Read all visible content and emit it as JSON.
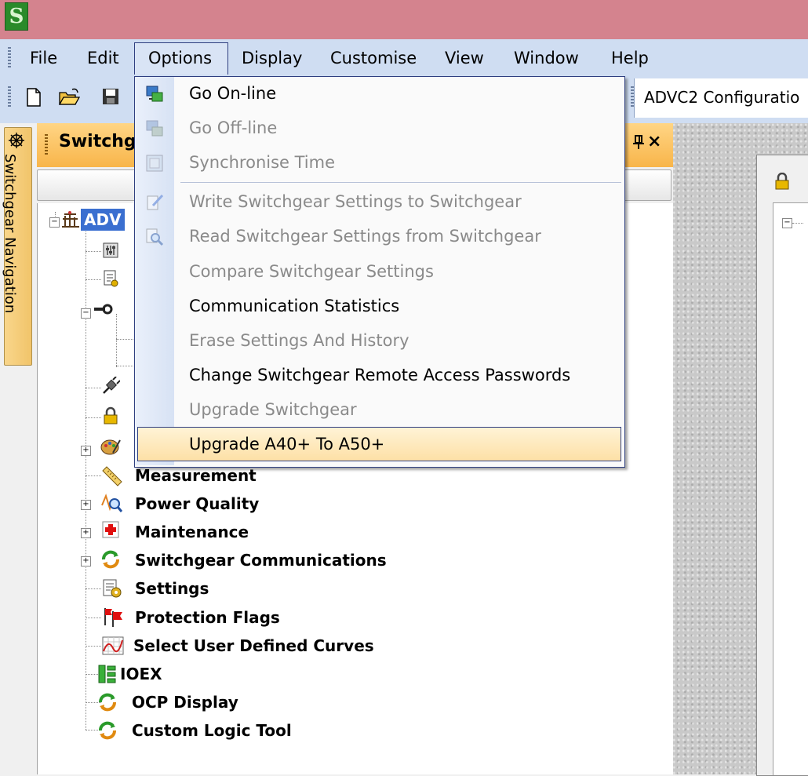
{
  "app": {
    "icon_glyph": "S",
    "accent": "#d4838e",
    "menu_bg": "#cfddf2",
    "panel_orange": "#f8b54a"
  },
  "menubar": {
    "items": [
      {
        "label": "File"
      },
      {
        "label": "Edit"
      },
      {
        "label": "Options"
      },
      {
        "label": "Display"
      },
      {
        "label": "Customise"
      },
      {
        "label": "View"
      },
      {
        "label": "Window"
      },
      {
        "label": "Help"
      }
    ]
  },
  "toolbar": {
    "icons": [
      "new-file-icon",
      "open-folder-icon",
      "save-icon"
    ],
    "config_value": "ADVC2 Configuratio"
  },
  "side_tab": {
    "label": "Switchgear Navigation",
    "icon": "wheel-icon"
  },
  "panel": {
    "title": "Switchg",
    "pin_glyph": "ᴨ",
    "close_glyph": "×",
    "root_label": "ADV"
  },
  "tree": {
    "items": [
      {
        "label": "Measurement",
        "icon": "ruler-icon"
      },
      {
        "label": "Power Quality",
        "icon": "waveform-magnifier-icon"
      },
      {
        "label": "Maintenance",
        "icon": "red-cross-icon"
      },
      {
        "label": "Switchgear Communications",
        "icon": "communications-icon"
      },
      {
        "label": "Settings",
        "icon": "settings-icon"
      },
      {
        "label": "Protection Flags",
        "icon": "flags-icon"
      },
      {
        "label": "Select User Defined Curves",
        "icon": "curves-icon"
      },
      {
        "label": "IOEX",
        "icon": "ioex-icon"
      },
      {
        "label": "OCP Display",
        "icon": "ocp-icon"
      },
      {
        "label": "Custom Logic Tool",
        "icon": "logic-icon"
      }
    ]
  },
  "dropdown": {
    "items": [
      {
        "label": "Go On-line",
        "enabled": true,
        "icon": "go-online-icon"
      },
      {
        "label": "Go Off-line",
        "enabled": false,
        "icon": "go-offline-icon"
      },
      {
        "label": "Synchronise Time",
        "enabled": false,
        "icon": "sync-time-icon"
      },
      {
        "label": "Write Switchgear Settings to Switchgear",
        "enabled": false,
        "icon": "write-settings-icon"
      },
      {
        "label": "Read Switchgear Settings from Switchgear",
        "enabled": false,
        "icon": "read-settings-icon"
      },
      {
        "label": "Compare Switchgear Settings",
        "enabled": false
      },
      {
        "label": "Communication Statistics",
        "enabled": true
      },
      {
        "label": "Erase Settings And History",
        "enabled": false
      },
      {
        "label": "Change Switchgear Remote Access Passwords",
        "enabled": true
      },
      {
        "label": "Upgrade Switchgear",
        "enabled": false
      },
      {
        "label": "Upgrade A40+ To A50+",
        "enabled": true,
        "highlighted": true
      }
    ]
  }
}
